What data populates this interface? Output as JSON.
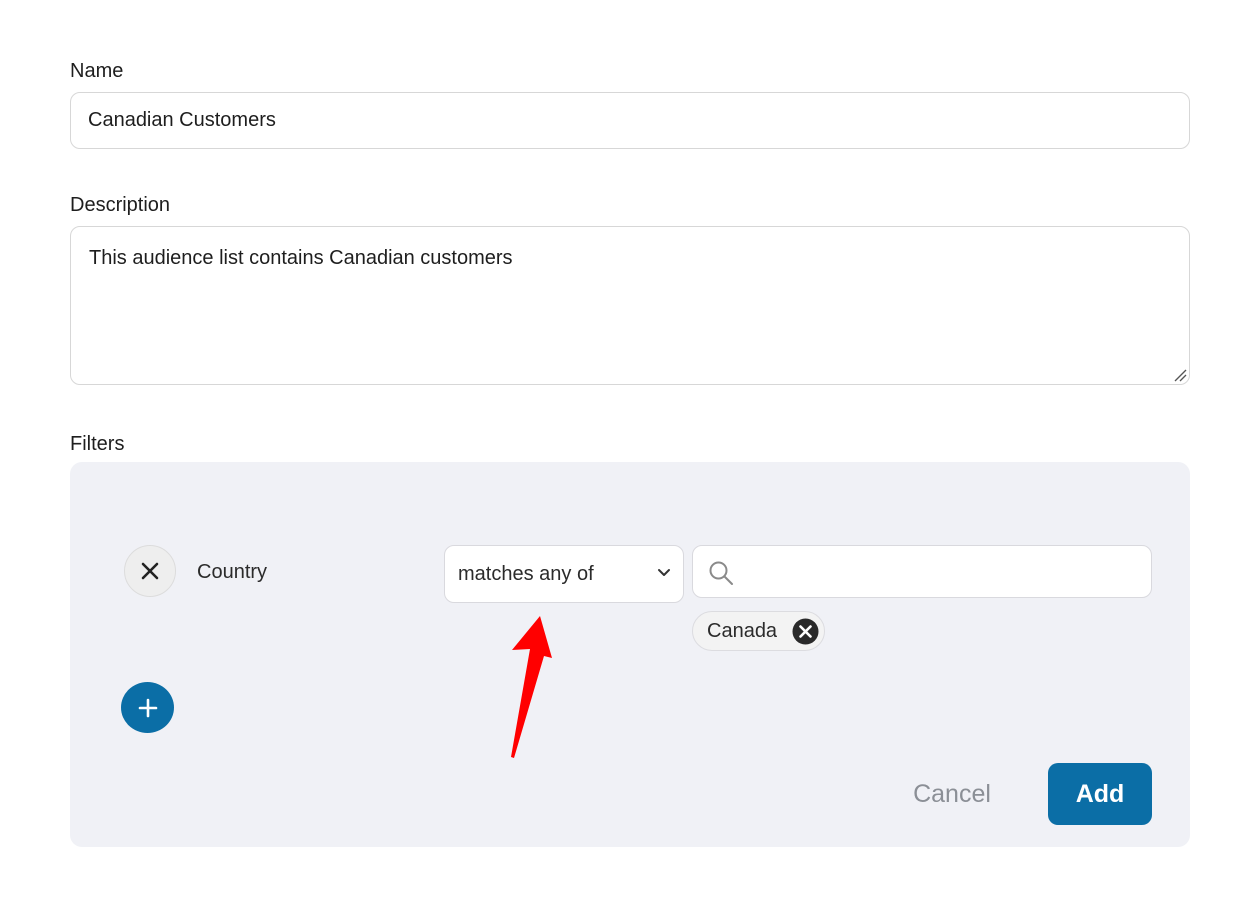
{
  "form": {
    "name_label": "Name",
    "name_value": "Canadian Customers",
    "description_label": "Description",
    "description_value": "This audience list contains Canadian customers",
    "filters_label": "Filters"
  },
  "filter": {
    "field": "Country",
    "operator": "matches any of",
    "search_value": "",
    "selected_values": [
      "Canada"
    ]
  },
  "actions": {
    "cancel_label": "Cancel",
    "add_label": "Add"
  },
  "icons": {
    "remove_filter": "close-icon",
    "operator_dropdown": "chevron-down-icon",
    "search": "search-icon",
    "remove_chip": "close-circle-icon",
    "add_filter": "plus-icon",
    "annotation": "red-arrow-icon"
  },
  "colors": {
    "primary": "#0b6ea6",
    "panel_bg": "#f0f1f6",
    "annotation": "#ff0000"
  }
}
